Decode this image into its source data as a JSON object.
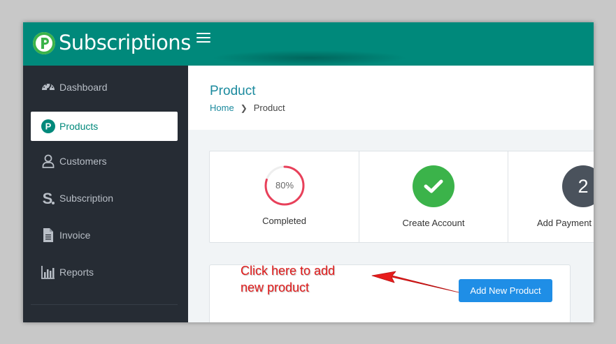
{
  "app": {
    "brand": "Subscriptions",
    "logo_letter": "P"
  },
  "colors": {
    "topbar": "#00897b",
    "sidebar": "#262c34",
    "accent": "#1b8a9e",
    "success": "#3bb34a",
    "progress": "#e8405a",
    "button": "#1f8ee6",
    "annotation": "#e01b1b"
  },
  "sidebar": {
    "items": [
      {
        "label": "Dashboard",
        "icon": "dashboard-gauge-icon",
        "active": false
      },
      {
        "label": "Products",
        "icon": "products-p-icon",
        "active": true
      },
      {
        "label": "Customers",
        "icon": "user-icon",
        "active": false
      },
      {
        "label": "Subscription",
        "icon": "subscription-s-icon",
        "active": false
      },
      {
        "label": "Invoice",
        "icon": "document-icon",
        "active": false
      },
      {
        "label": "Reports",
        "icon": "bar-chart-icon",
        "active": false
      }
    ]
  },
  "header": {
    "title": "Product",
    "breadcrumb": {
      "home": "Home",
      "current": "Product"
    }
  },
  "steps": [
    {
      "label": "Completed",
      "progress_text": "80%",
      "progress": 0.8
    },
    {
      "label": "Create Account",
      "icon": "check-icon"
    },
    {
      "label": "Add Payment",
      "number": "2"
    }
  ],
  "panel": {
    "button_label": "Add New Product"
  },
  "annotation": {
    "line1": "Click here to add",
    "line2": "new product"
  }
}
